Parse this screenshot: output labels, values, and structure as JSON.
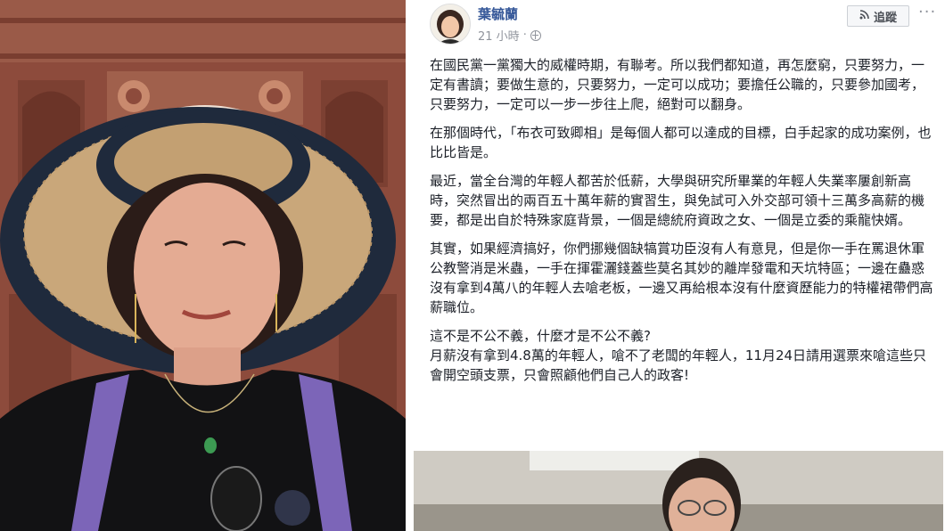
{
  "post": {
    "author": "葉毓蘭",
    "time": "21 小時",
    "separator": "·",
    "follow_label": "追蹤",
    "more_label": "···",
    "paragraphs": [
      "在國民黨一黨獨大的威權時期，有聯考。所以我們都知道，再怎麼窮，只要努力，一定有書讀；要做生意的，只要努力，一定可以成功；要擔任公職的，只要參加國考，只要努力，一定可以一步一步往上爬，絕對可以翻身。",
      "在那個時代，「布衣可致卿相」是每個人都可以達成的目標，白手起家的成功案例，也比比皆是。",
      "最近，當全台灣的年輕人都苦於低薪，大學與研究所畢業的年輕人失業率屢創新高時，突然冒出的兩百五十萬年薪的實習生，與免試可入外交部可領十三萬多高薪的機要，都是出自於特殊家庭背景，一個是總統府資政之女、一個是立委的乘龍快婿。",
      "其實，如果經濟搞好，你們挪幾個缺犒賞功臣沒有人有意見，但是你一手在罵退休軍公教警消是米蟲，一手在揮霍灑錢蓋些莫名其妙的離岸發電和天坑特區；一邊在蠱惑沒有拿到4萬八的年輕人去嗆老板，一邊又再給根本沒有什麼資歷能力的特權裙帶們高薪職位。",
      "這不是不公不義，什麼才是不公不義?\n月薪沒有拿到4.8萬的年輕人，嗆不了老闆的年輕人，11月24日請用選票來嗆這些只會開空頭支票，只會照顧他們自己人的政客!"
    ]
  },
  "colors": {
    "author": "#365899",
    "meta": "#90949c",
    "text": "#1d2129"
  },
  "icons": {
    "globe": "globe-icon",
    "rss": "rss-icon",
    "more": "more-icon"
  }
}
